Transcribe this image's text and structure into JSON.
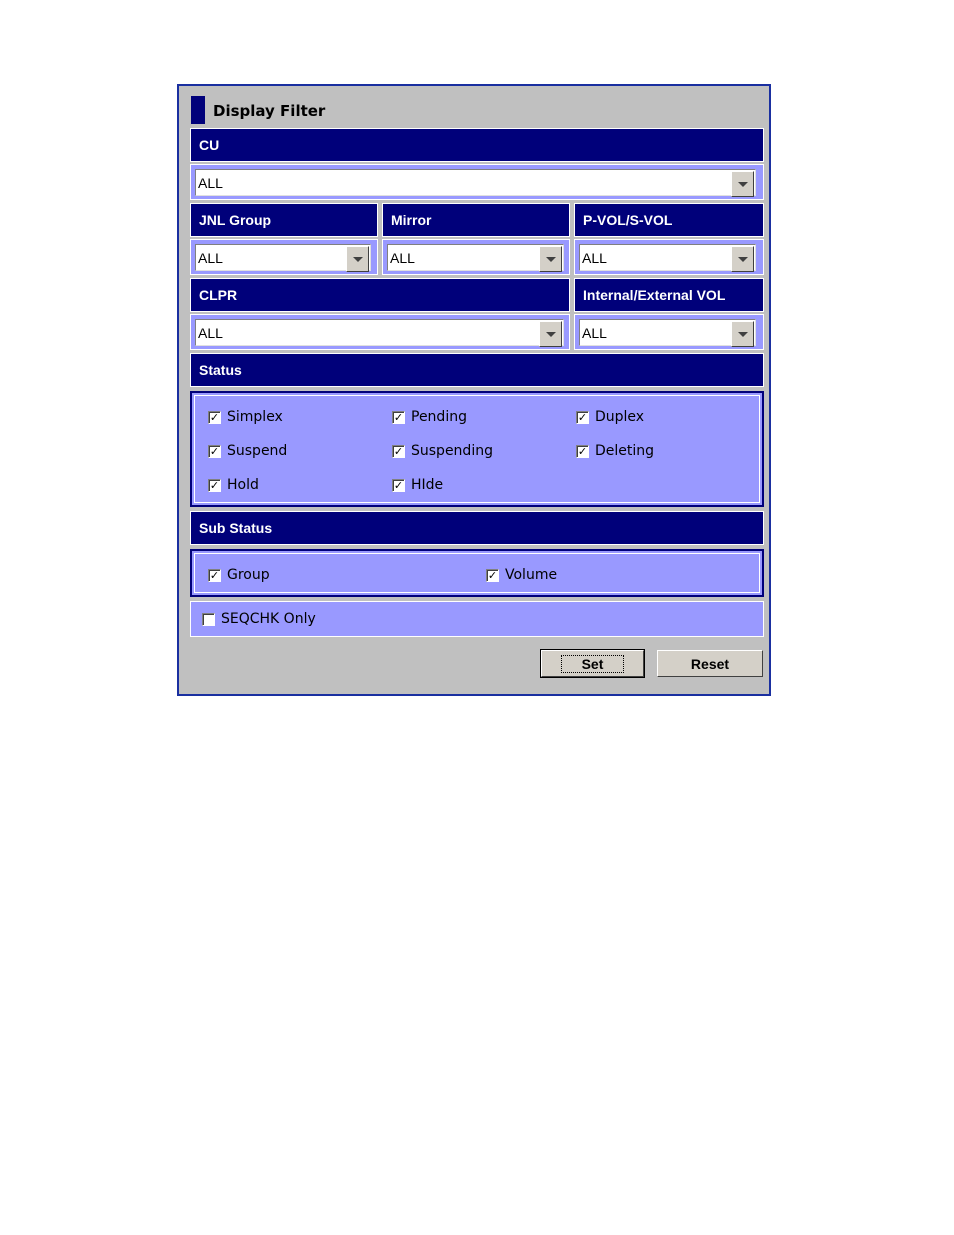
{
  "dialog": {
    "title": "Display Filter"
  },
  "cu": {
    "label": "CU",
    "value": "ALL"
  },
  "row2": {
    "jnl_group_label": "JNL Group",
    "jnl_group_value": "ALL",
    "mirror_label": "Mirror",
    "mirror_value": "ALL",
    "pvol_label": "P-VOL/S-VOL",
    "pvol_value": "ALL"
  },
  "row3": {
    "clpr_label": "CLPR",
    "clpr_value": "ALL",
    "int_ext_label": "Internal/External VOL",
    "int_ext_value": "ALL"
  },
  "status": {
    "label": "Status",
    "items": [
      {
        "label": "Simplex",
        "checked": true
      },
      {
        "label": "Pending",
        "checked": true
      },
      {
        "label": "Duplex",
        "checked": true
      },
      {
        "label": "Suspend",
        "checked": true
      },
      {
        "label": "Suspending",
        "checked": true
      },
      {
        "label": "Deleting",
        "checked": true
      },
      {
        "label": "Hold",
        "checked": true
      },
      {
        "label": "HIde",
        "checked": true
      }
    ]
  },
  "sub_status": {
    "label": "Sub Status",
    "items": [
      {
        "label": "Group",
        "checked": true
      },
      {
        "label": "Volume",
        "checked": true
      }
    ]
  },
  "seqchk": {
    "label": "SEQCHK Only",
    "checked": false
  },
  "buttons": {
    "set": "Set",
    "reset": "Reset"
  },
  "colors": {
    "header": "#00007a",
    "panel": "#9999ff",
    "dialog_bg": "#c0c0c0",
    "border": "#1a2fa0"
  }
}
